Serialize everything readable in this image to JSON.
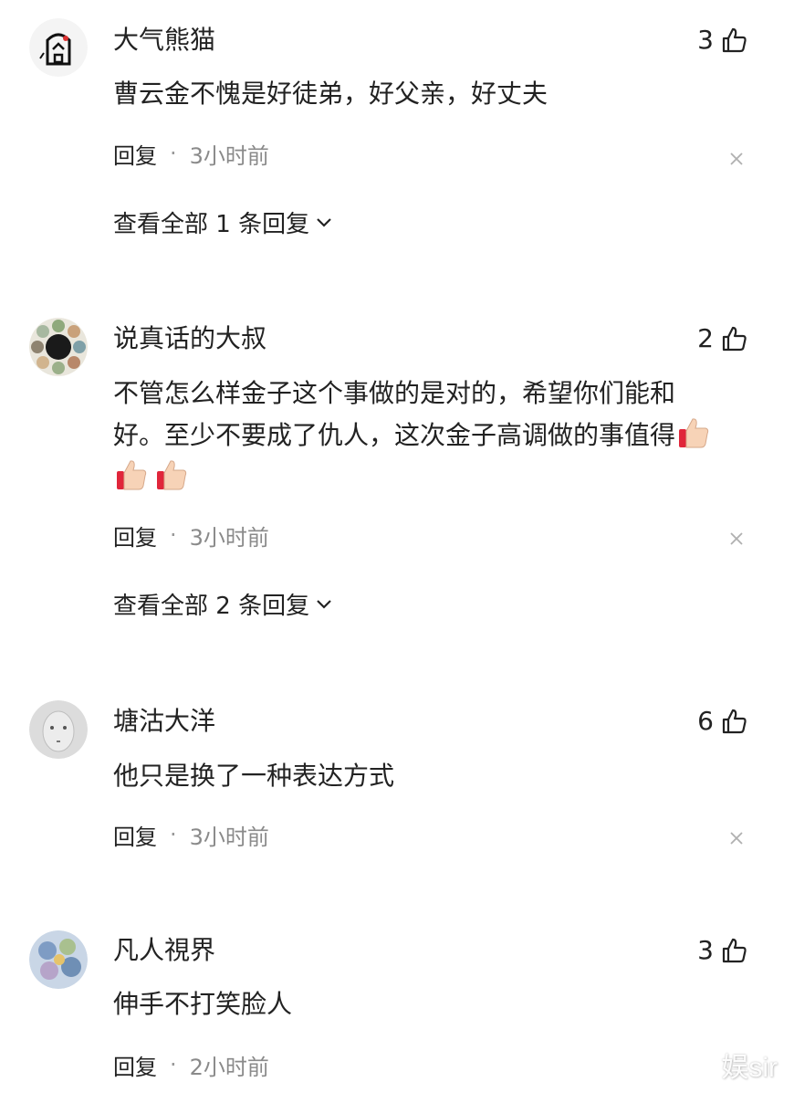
{
  "comments": [
    {
      "username": "大气熊猫",
      "likes": "3",
      "text": "曹云金不愧是好徒弟，好父亲，好丈夫",
      "reply_label": "回复",
      "separator": "·",
      "time": "3小时前",
      "expand_label": "查看全部 1 条回复"
    },
    {
      "username": "说真话的大叔",
      "likes": "2",
      "text": "不管怎么样金子这个事做的是对的，希望你们能和好。至少不要成了仇人，这次金子高调做的事值得",
      "reply_label": "回复",
      "separator": "·",
      "time": "3小时前",
      "expand_label": "查看全部 2 条回复"
    },
    {
      "username": "塘沽大洋",
      "likes": "6",
      "text": "他只是换了一种表达方式",
      "reply_label": "回复",
      "separator": "·",
      "time": "3小时前"
    },
    {
      "username": "凡人視界",
      "likes": "3",
      "text": "伸手不打笑脸人",
      "reply_label": "回复",
      "separator": "·",
      "time": "2小时前"
    }
  ],
  "icons": {
    "like": "thumbs-up-icon",
    "close": "close-icon",
    "expand": "chevron-down-icon",
    "emoji": "thumbs-up-emoji-icon"
  },
  "watermark": "娱sir"
}
